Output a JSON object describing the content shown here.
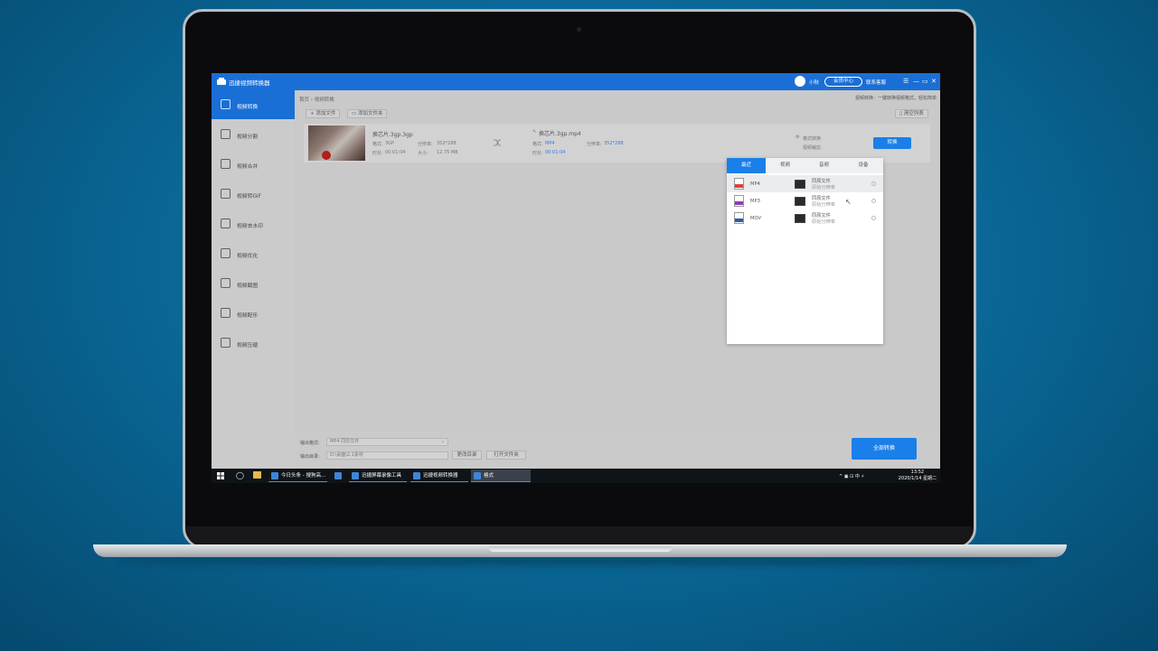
{
  "app": {
    "title": "迅捷视频转换器",
    "user_name": "小秋",
    "vip_label": "会员中心",
    "support_label": "联系客服",
    "window_controls": [
      "☰",
      "—",
      "▭",
      "✕"
    ]
  },
  "sidebar": {
    "items": [
      {
        "label": "视频转换",
        "active": true
      },
      {
        "label": "视频分割",
        "active": false
      },
      {
        "label": "视频合并",
        "active": false
      },
      {
        "label": "视频转GIF",
        "active": false
      },
      {
        "label": "视频去水印",
        "active": false
      },
      {
        "label": "视频优化",
        "active": false
      },
      {
        "label": "视频截图",
        "active": false
      },
      {
        "label": "视频配乐",
        "active": false
      },
      {
        "label": "视频压缩",
        "active": false
      }
    ]
  },
  "main": {
    "breadcrumb": "首页 › 视频转换",
    "tip": "视频转换：一键转换视频格式，轻松简单",
    "add_file": "添加文件",
    "add_folder": "添加文件夹",
    "clear_list": "清空列表",
    "file": {
      "source_name": "换芯片.3gp.3gp",
      "src_format_label": "格式:",
      "src_format": "3GP",
      "src_resolution_label": "分辨率:",
      "src_resolution": "352*288",
      "src_duration_label": "时长:",
      "src_duration": "00:01:04",
      "src_size_label": "大小:",
      "src_size": "12.75 MB",
      "target_name": "换芯片.3gp.mp4",
      "tgt_format_label": "格式:",
      "tgt_format": "MP4",
      "tgt_resolution_label": "分辨率:",
      "tgt_resolution": "352*288",
      "tgt_duration_label": "时长:",
      "tgt_duration": "00:01:04",
      "settings_1": "格式转换",
      "settings_2": "视频裁剪",
      "convert_label": "转换"
    },
    "dropdown": {
      "tabs": [
        "最近",
        "视频",
        "音频",
        "设备"
      ],
      "active_tab": "最近",
      "rows": [
        {
          "format": "MP4",
          "quality": "同原文件",
          "sub": "原始分辨率",
          "color": "#d9433b"
        },
        {
          "format": "MP3",
          "quality": "同原文件",
          "sub": "原始分辨率",
          "color": "#8a3fb0"
        },
        {
          "format": "MOV",
          "quality": "同原文件",
          "sub": "原始分辨率",
          "color": "#2a5ea8"
        }
      ]
    }
  },
  "bottom": {
    "output_format_label": "输出格式:",
    "output_format_value": "MP4 同原文件",
    "output_dir_label": "输出目录:",
    "output_dir_value": "D:\\桌面\\2.1素材",
    "change_dir": "更改目录",
    "open_folder": "打开文件夹",
    "convert_all": "全部转换"
  },
  "taskbar": {
    "items": [
      {
        "label": "今日头条 - 搜狗高..."
      },
      {
        "label": ""
      },
      {
        "label": "迅捷屏幕录像工具"
      },
      {
        "label": "迅捷视频转换器"
      },
      {
        "label": "格式"
      }
    ],
    "tray": "^ ▣ ⊡ 中 ⚡",
    "time": "13:52",
    "date": "2020/1/14 星期二"
  }
}
